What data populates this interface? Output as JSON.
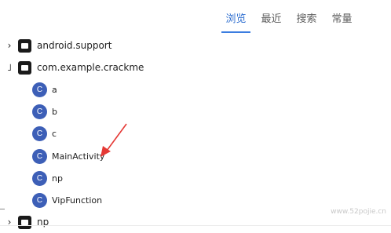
{
  "tabs": [
    {
      "label": "浏览",
      "active": true
    },
    {
      "label": "最近",
      "active": false
    },
    {
      "label": "搜索",
      "active": false
    },
    {
      "label": "常量",
      "active": false
    }
  ],
  "tree": {
    "folders": [
      {
        "label": "android.support",
        "toggle": "›"
      },
      {
        "label": "com.example.crackme",
        "toggle": "˩"
      },
      {
        "label": "np",
        "toggle": "›"
      }
    ],
    "classes": [
      {
        "icon_letter": "C",
        "label": "a"
      },
      {
        "icon_letter": "C",
        "label": "b"
      },
      {
        "icon_letter": "C",
        "label": "c"
      },
      {
        "icon_letter": "C",
        "label": "MainActivity"
      },
      {
        "icon_letter": "C",
        "label": "np"
      },
      {
        "icon_letter": "C",
        "label": "VipFunction"
      }
    ]
  },
  "annotation": {
    "arrow_color": "#e53935"
  },
  "colors": {
    "accent": "#3b7de0",
    "class_icon": "#3d5fb7"
  },
  "watermark": "www.52pojie.cn"
}
